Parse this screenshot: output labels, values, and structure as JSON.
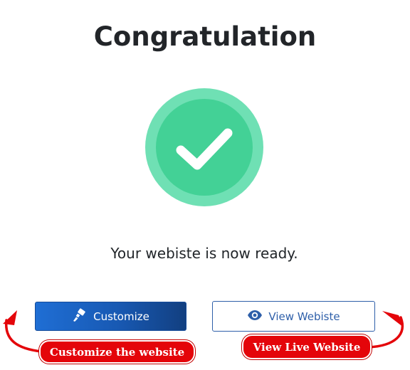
{
  "card": {
    "title": "Congratulation",
    "message": "Your webiste is now ready."
  },
  "buttons": {
    "customize_label": "Customize",
    "view_label": "View Webiste"
  },
  "annotations": {
    "left_label": "Customize the website",
    "right_label": "View Live Website"
  },
  "icons": {
    "success": "check-circle-icon",
    "customize": "paint-brush-icon",
    "view": "eye-icon"
  },
  "colors": {
    "success_outer": "#6fe0b4",
    "success_inner": "#43d196",
    "primary": "#1859b3",
    "outline": "#2e5fa9",
    "annotation": "#e4050a"
  }
}
